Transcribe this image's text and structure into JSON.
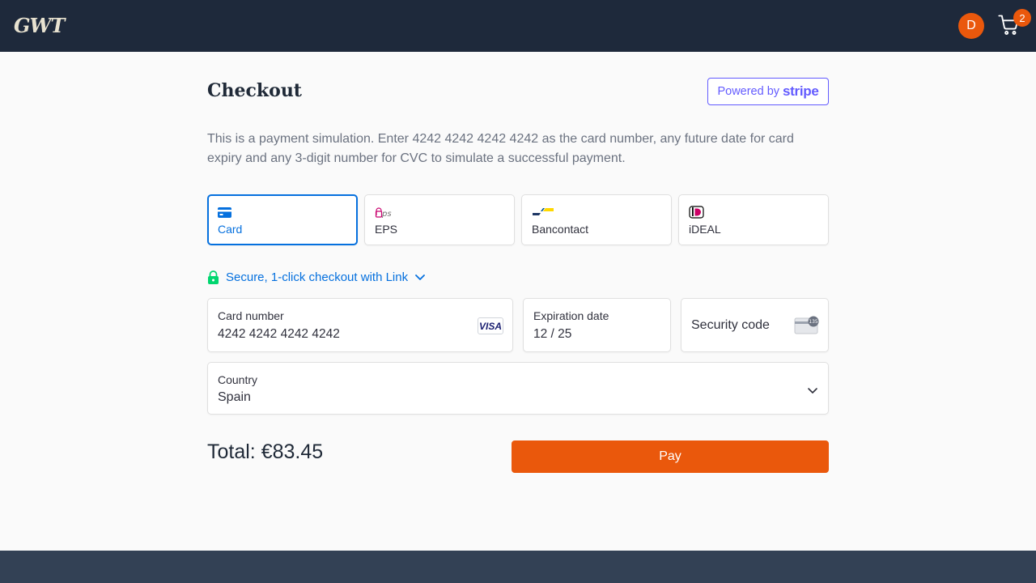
{
  "header": {
    "logo": "GWT",
    "avatar_initial": "D",
    "cart_count": "2",
    "colors": {
      "bar": "#1e293b",
      "accent": "#ea580c"
    }
  },
  "checkout": {
    "title": "Checkout",
    "powered_by": "Powered by",
    "stripe_brand": "stripe",
    "description": "This is a payment simulation. Enter 4242 4242 4242 4242 as the card number, any future date for card expiry and any 3-digit number for CVC to simulate a successful payment."
  },
  "payment_methods": [
    {
      "label": "Card",
      "icon": "card-icon",
      "selected": true
    },
    {
      "label": "EPS",
      "icon": "eps-icon",
      "selected": false
    },
    {
      "label": "Bancontact",
      "icon": "bancontact-icon",
      "selected": false
    },
    {
      "label": "iDEAL",
      "icon": "ideal-icon",
      "selected": false
    }
  ],
  "link": {
    "label": "Secure, 1-click checkout with Link"
  },
  "form": {
    "card_number_label": "Card number",
    "card_number_value": "4242 4242 4242 4242",
    "card_brand": "VISA",
    "expiry_label": "Expiration date",
    "expiry_value": "12 / 25",
    "cvc_placeholder": "Security code",
    "cvc_icon_text": "135",
    "country_label": "Country",
    "country_value": "Spain"
  },
  "summary": {
    "total": "Total: €83.45",
    "pay_label": "Pay"
  },
  "colors": {
    "stripe": "#635bff",
    "link_blue": "#0570de",
    "pay": "#ea580c"
  }
}
